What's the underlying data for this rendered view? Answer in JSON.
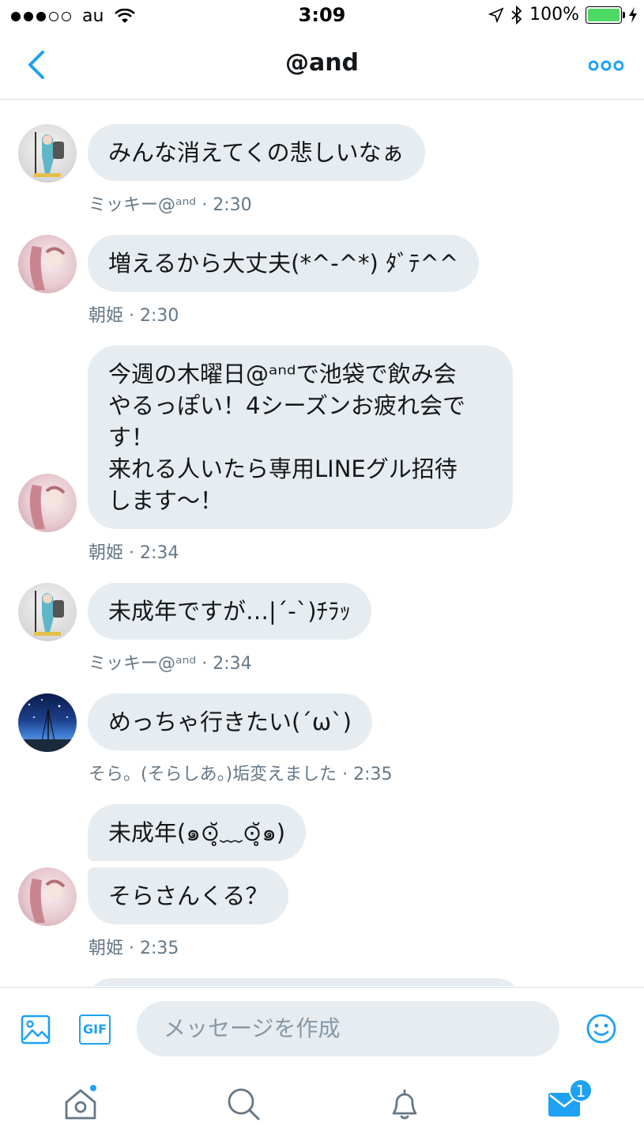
{
  "status_bar": {
    "carrier": "au",
    "time": "3:09",
    "battery": "100%"
  },
  "header": {
    "title": "@and"
  },
  "messages": [
    {
      "text": "みんな消えてくの悲しいなぁ",
      "meta": "ミッキー@ᵃⁿᵈ · 2:30"
    },
    {
      "text": "増えるから大丈夫(*^-^*) ﾀﾞﾃ^^",
      "meta": "朝姫 · 2:30"
    },
    {
      "text": "今週の木曜日@ᵃⁿᵈで池袋で飲み会\nやるっぽい！4シーズンお疲れ会で\nす！\n来れる人いたら専用LINEグル招待\nします〜！",
      "meta": "朝姫 · 2:34"
    },
    {
      "text": "未成年ですが…|´-`)ﾁﾗｯ",
      "meta": "ミッキー@ᵃⁿᵈ · 2:34"
    },
    {
      "text": "めっちゃ行きたい(´ω`)",
      "meta": "そら。(そらしあ。)垢変えました · 2:35"
    },
    {
      "text": "未成年(๑⊙̥̆﹏⊙̥̆๑)",
      "meta": ""
    },
    {
      "text": "そらさんくる？",
      "meta": "朝姫 · 2:35"
    }
  ],
  "composer": {
    "placeholder": "メッセージを作成",
    "gif_label": "GIF"
  },
  "tabbar": {
    "messages_badge": "1"
  },
  "colors": {
    "accent": "#1da1f2",
    "bubble": "#e6ecf0",
    "meta": "#657786"
  }
}
